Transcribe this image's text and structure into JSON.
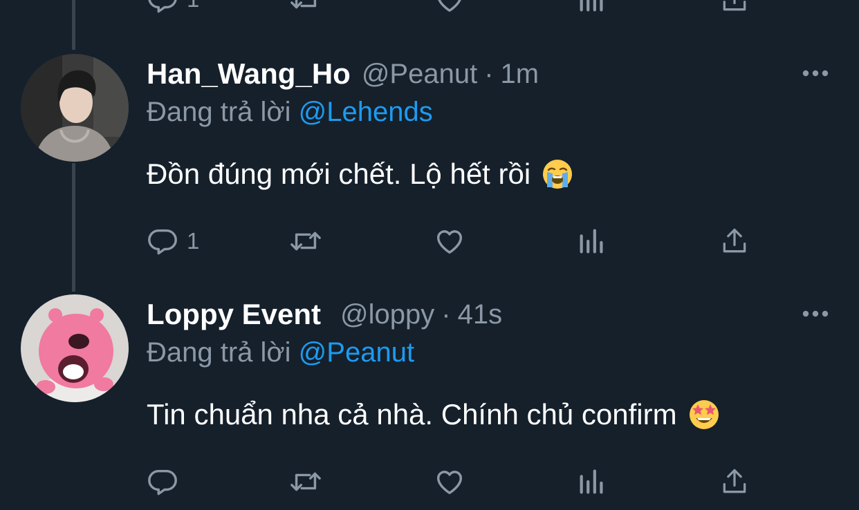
{
  "tweets": [
    {
      "name": "Han_Wang_Ho",
      "handle": "@Peanut",
      "separator": "·",
      "time": "1m",
      "reply_prefix": "Đang trả lời",
      "reply_to": "@Lehends",
      "text": "Đồn đúng mới chết. Lộ hết rồi",
      "emoji": "loudly-crying-face",
      "reply_count": "1",
      "avatar": "photo-avatar"
    },
    {
      "name": "Loppy Event",
      "handle": "@loppy",
      "separator": "·",
      "time": "41s",
      "reply_prefix": "Đang trả lời",
      "reply_to": "@Peanut",
      "text": "Tin chuẩn nha cả nhà. Chính chủ confirm",
      "emoji": "star-struck-face",
      "reply_count": "",
      "avatar": "pink-beaver-avatar"
    }
  ],
  "top_actions": {
    "reply_count": "1"
  },
  "colors": {
    "background": "#15202b",
    "text_primary": "#ffffff",
    "text_secondary": "#8b98a5",
    "mention": "#1d9bf0",
    "thread_line": "#38444d"
  }
}
